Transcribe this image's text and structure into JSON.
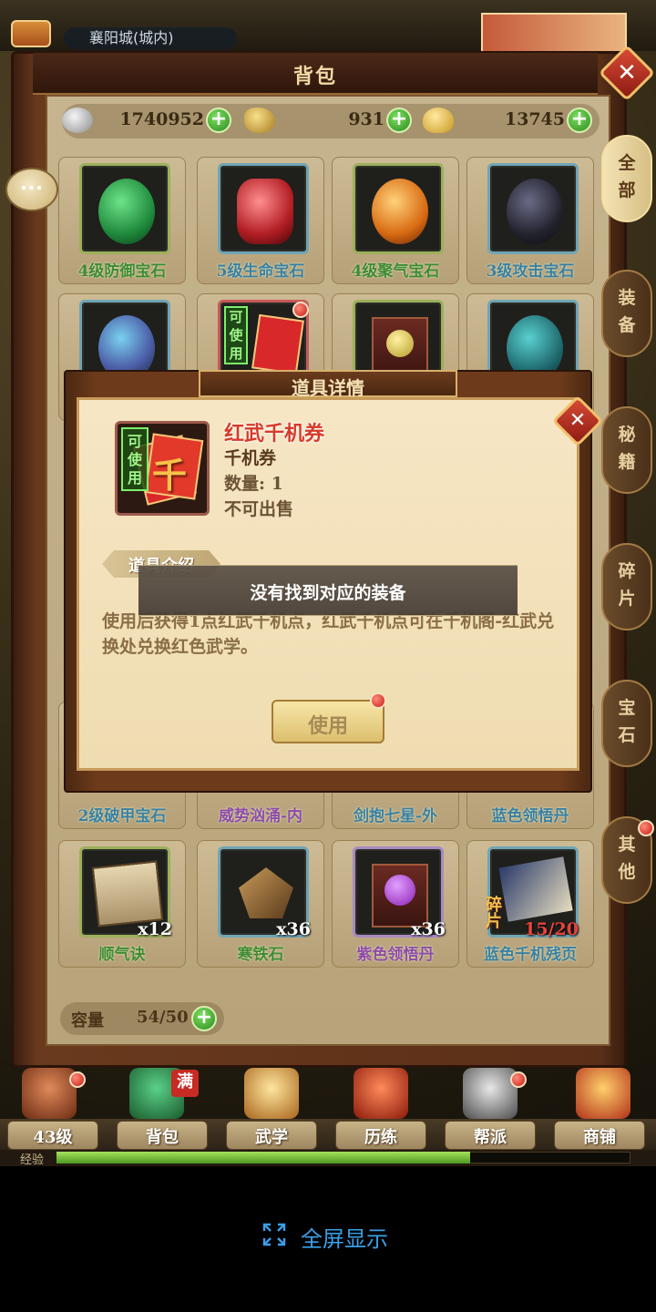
{
  "top": {
    "map_name": "襄阳城(城内)"
  },
  "bag": {
    "title": "背包",
    "currency": [
      {
        "name": "silver",
        "value": "1740952"
      },
      {
        "name": "gold",
        "value": "931"
      },
      {
        "name": "yuanbao",
        "value": "13745"
      }
    ],
    "capacity_label": "容量",
    "capacity_value": "54/50",
    "rows": [
      [
        {
          "name": "4级防御宝石",
          "gem_color": "#1f8a3c",
          "rarity": "green"
        },
        {
          "name": "5级生命宝石",
          "gem_color": "#b21e24",
          "rarity": "blue"
        },
        {
          "name": "4级聚气宝石",
          "gem_color": "#d86a12",
          "rarity": "green"
        },
        {
          "name": "3级攻击宝石",
          "gem_color": "#23232e",
          "rarity": "blue"
        }
      ],
      [
        {
          "name": "",
          "gem_color": "#4c5fa8",
          "rarity": "blue"
        },
        {
          "name": "",
          "gem_color": "#c2302a",
          "rarity": "red",
          "usable": "可使用"
        },
        {
          "name": "",
          "gem_color": "#b39a2a",
          "rarity": "green"
        },
        {
          "name": "",
          "gem_color": "#1f6a6e",
          "rarity": "blue"
        }
      ],
      [
        {
          "name": "2级破甲宝石",
          "rarity": "blue"
        },
        {
          "name": "威势汹涌-内",
          "rarity": "purple"
        },
        {
          "name": "剑抱七星-外",
          "rarity": "blue"
        },
        {
          "name": "蓝色领悟丹",
          "rarity": "blue"
        }
      ],
      [
        {
          "name": "顺气诀",
          "count": "x12",
          "rarity": "green"
        },
        {
          "name": "寒铁石",
          "count": "x36",
          "rarity": "green"
        },
        {
          "name": "紫色领悟丹",
          "count": "x36",
          "rarity": "purple"
        },
        {
          "name": "蓝色千机残页",
          "count": "15/20",
          "fragment": "碎片",
          "rarity": "blue"
        }
      ]
    ],
    "side_tabs": [
      "全部",
      "装备",
      "秘籍",
      "碎片",
      "宝石",
      "其他"
    ]
  },
  "chat": {
    "label": "···"
  },
  "detail": {
    "title": "道具详情",
    "item_name": "红武千机券",
    "item_type": "千机券",
    "item_qty": "数量: 1",
    "item_sell": "不可出售",
    "icon_usable": "可使用",
    "icon_char": "千",
    "section_label": "道具介绍",
    "description": "使用后获得1点红武千机点，红武千机点可在千机阁-红武兑换处兑换红色武学。",
    "use_label": "使用"
  },
  "toast": {
    "message": "没有找到对应的装备"
  },
  "nav": {
    "tabs": [
      "43级",
      "背包",
      "武学",
      "历练",
      "帮派",
      "商铺"
    ],
    "full_badge": "满",
    "exp_label": "经验",
    "exp_progress": 0.72
  },
  "footer": {
    "fullscreen_label": "全屏显示"
  }
}
